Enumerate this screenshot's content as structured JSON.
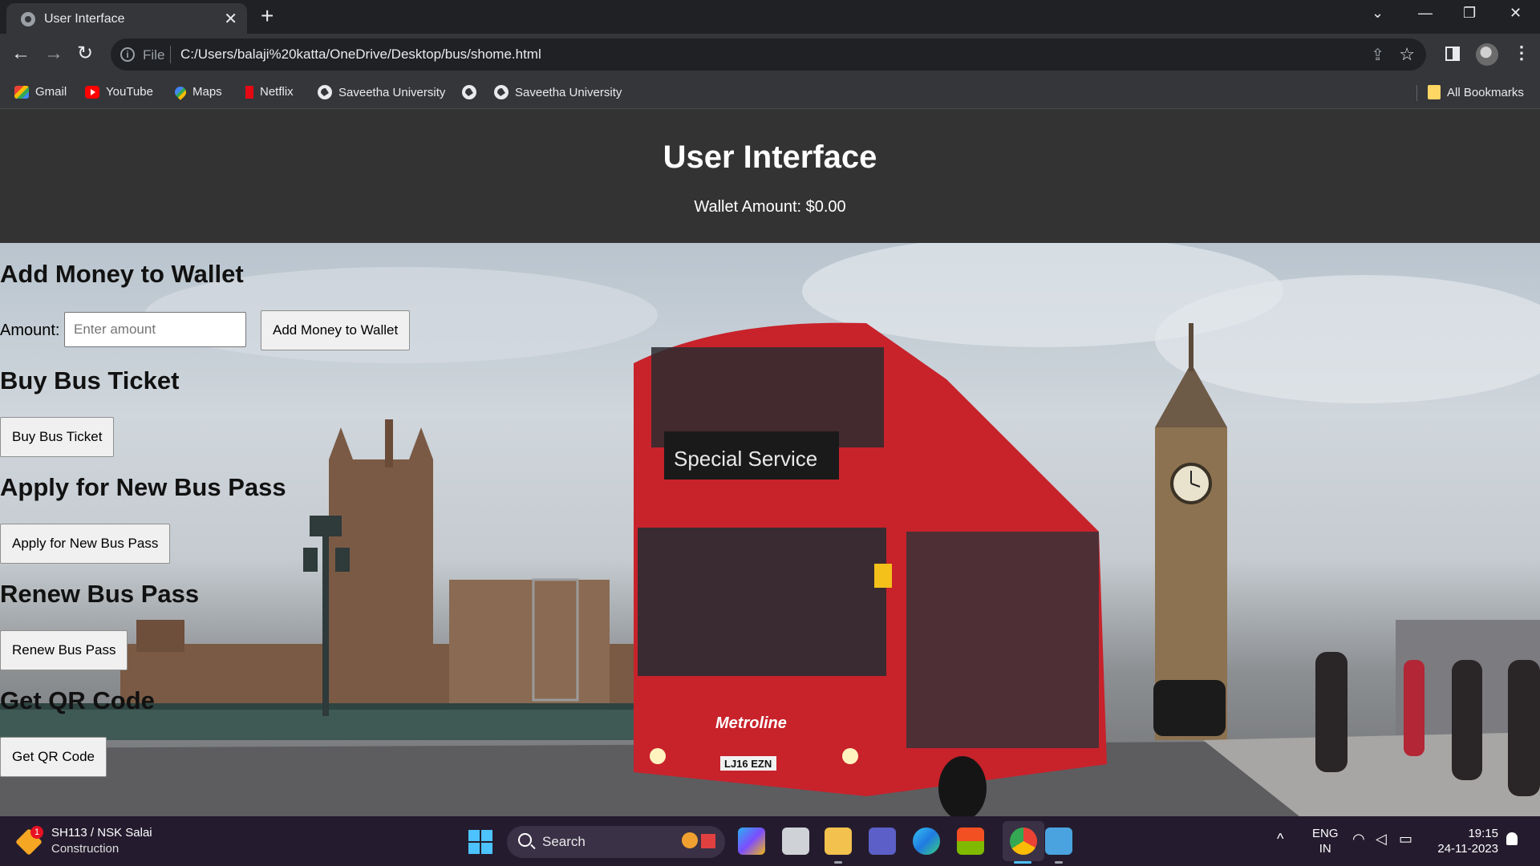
{
  "browser": {
    "tab_title": "User Interface",
    "tab_close": "✕",
    "new_tab": "+",
    "url_scheme": "File",
    "url": "C:/Users/balaji%20katta/OneDrive/Desktop/bus/shome.html",
    "bookmarks": [
      {
        "label": "Gmail",
        "icon": "gmail-icon"
      },
      {
        "label": "YouTube",
        "icon": "youtube-icon"
      },
      {
        "label": "Maps",
        "icon": "maps-icon"
      },
      {
        "label": "Netflix",
        "icon": "netflix-icon"
      },
      {
        "label": "Saveetha University",
        "icon": "globe-icon"
      },
      {
        "label": "",
        "icon": "globe-icon"
      },
      {
        "label": "Saveetha University",
        "icon": "globe-icon"
      }
    ],
    "all_bookmarks": "All Bookmarks"
  },
  "page": {
    "title": "User Interface",
    "wallet": "Wallet Amount: $0.00",
    "add_money": {
      "heading": "Add Money to Wallet",
      "amount_label": "Amount:",
      "placeholder": "Enter amount",
      "button": "Add Money to Wallet"
    },
    "buy_ticket": {
      "heading": "Buy Bus Ticket",
      "button": "Buy Bus Ticket"
    },
    "new_pass": {
      "heading": "Apply for New Bus Pass",
      "button": "Apply for New Bus Pass"
    },
    "renew_pass": {
      "heading": "Renew Bus Pass",
      "button": "Renew Bus Pass"
    },
    "qr_code": {
      "heading": "Get QR Code",
      "button": "Get QR Code"
    },
    "background_scene": {
      "bus_sign": "Special Service",
      "bus_brand": "Metroline",
      "bus_plate": "LJ16 EZN"
    }
  },
  "taskbar": {
    "weather_badge": "1",
    "weather_line1": "SH113 / NSK Salai",
    "weather_line2": "Construction",
    "search": "Search",
    "lang_line1": "ENG",
    "lang_line2": "IN",
    "time": "19:15",
    "date": "24-11-2023"
  }
}
